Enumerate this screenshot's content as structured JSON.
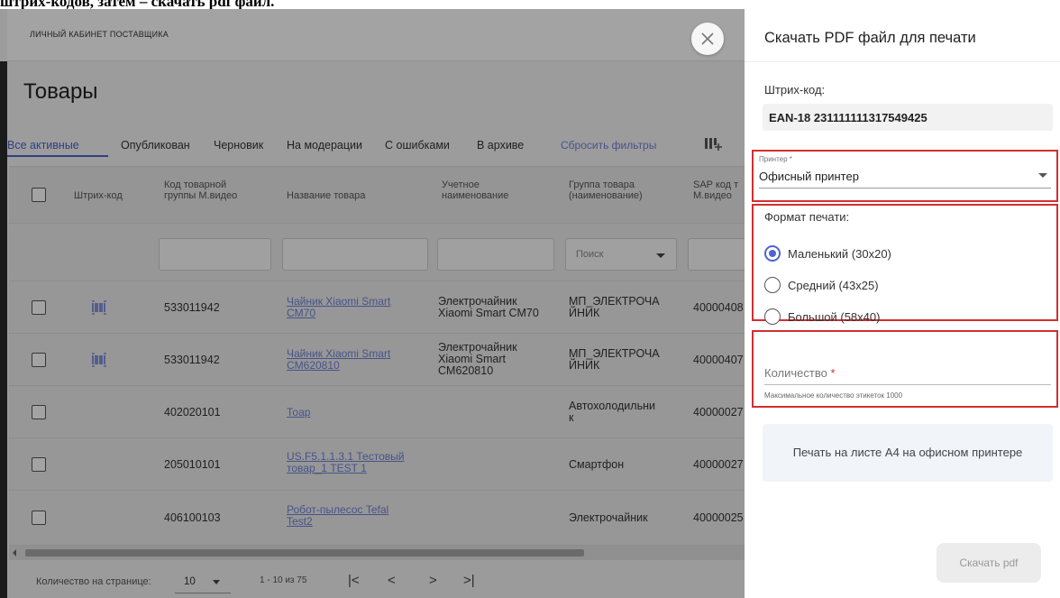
{
  "caption": "штрих-кодов, затем – скачать pdf файл.",
  "app": {
    "brand": "ЛИЧНЫЙ КАБИНЕТ ПОСТАВЩИКА",
    "page_title": "Товары",
    "filters": [
      {
        "label": "Все активные",
        "active": true
      },
      {
        "label": "Опубликован"
      },
      {
        "label": "Черновик"
      },
      {
        "label": "На модерации"
      },
      {
        "label": "С ошибками"
      },
      {
        "label": "В архиве"
      }
    ],
    "reset_filters": "Сбросить фильтры",
    "columns": {
      "barcode": "Штрих-код",
      "group_code": [
        "Код товарной",
        "группы М.видео"
      ],
      "name": "Название товара",
      "accounting_name": [
        "Учетное",
        "наименование"
      ],
      "product_group": [
        "Группа товара",
        "(наименование)"
      ],
      "sap_code": [
        "SAP код т",
        "М.видео"
      ]
    },
    "search_placeholder": "Поиск",
    "rows": [
      {
        "has_barcode": true,
        "code": "533011942",
        "name": [
          "Чайник Xiaomi Smart",
          "CM70"
        ],
        "accounting": [
          "Электрочайник",
          "Xiaomi Smart CM70"
        ],
        "group": [
          "МП_ЭЛЕКТРОЧА",
          "ЙНИК"
        ],
        "sap": "40000408"
      },
      {
        "has_barcode": true,
        "code": "533011942",
        "name": [
          "Чайник Xiaomi Smart",
          "CM620810"
        ],
        "accounting": [
          "Электрочайник",
          "Xiaomi Smart",
          "CM620810"
        ],
        "group": [
          "МП_ЭЛЕКТРОЧА",
          "ЙНИК"
        ],
        "sap": "40000407"
      },
      {
        "has_barcode": false,
        "code": "402020101",
        "name": [
          "Тоар"
        ],
        "accounting": [],
        "group": [
          "Автохолодильни",
          "к"
        ],
        "sap": "40000027"
      },
      {
        "has_barcode": false,
        "code": "205010101",
        "name": [
          "US.F5.1.1.3.1 Тестовый",
          "товар_1 TEST 1"
        ],
        "accounting": [],
        "group": [
          "Смартфон"
        ],
        "sap": "40000027"
      },
      {
        "has_barcode": false,
        "code": "406100103",
        "name": [
          "Робот-пылесос Tefal",
          "Test2"
        ],
        "accounting": [],
        "group": [
          "Электрочайник"
        ],
        "sap": "40000025"
      }
    ],
    "footer": {
      "per_page_label": "Количество на странице:",
      "per_page_value": "10",
      "range": "1 - 10 из 75",
      "first": "|<",
      "prev": "<",
      "next": ">",
      "last": ">|"
    }
  },
  "drawer": {
    "title": "Скачать PDF файл для печати",
    "barcode_label": "Штрих-код:",
    "barcode_value": "EAN-18 231111111317549425",
    "printer_label": "Принтер *",
    "printer_value": "Офисный принтер",
    "format_title": "Формат печати:",
    "formats": [
      {
        "label": "Маленький (30x20)",
        "selected": true
      },
      {
        "label": "Средний (43x25)",
        "selected": false
      },
      {
        "label": "Большой (58x40)",
        "selected": false
      }
    ],
    "quantity_label": "Количество",
    "quantity_required": "*",
    "quantity_hint": "Максимальное количество этикеток 1000",
    "a4_option": "Печать на листе А4 на офисном принтере",
    "download_label": "Скачать pdf"
  },
  "colors": {
    "accent": "#4c63d2",
    "highlight": "#d32f2f"
  }
}
